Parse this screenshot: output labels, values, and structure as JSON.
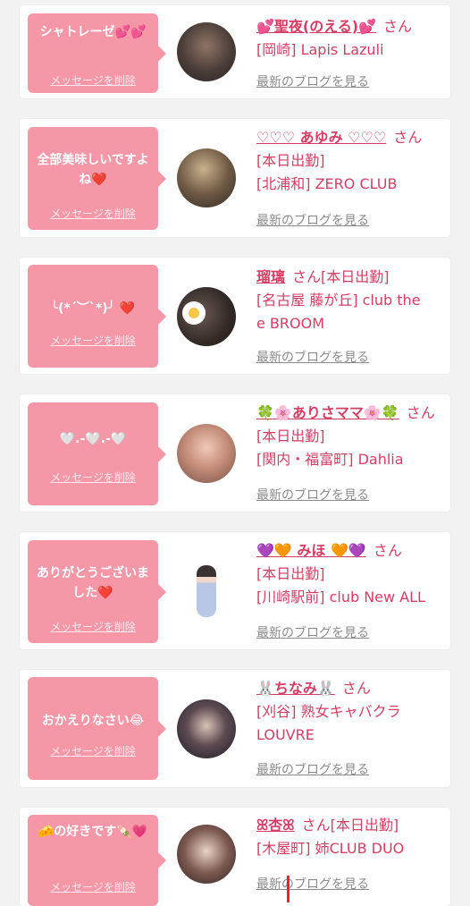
{
  "delete_label": "メッセージを削除",
  "blog_label": "最新のブログを見る",
  "san_label": "さん",
  "colors": {
    "bubble": "#f597a7",
    "accent": "#d73d63",
    "link_gray": "#8b8b8b"
  },
  "items": [
    {
      "message": "シャトレーゼ💕💕",
      "name": "💕聖夜(のえる)💕",
      "info_lines": [
        "[岡崎] Lapis Lazuli"
      ]
    },
    {
      "message": "全部美味しいですよね❤️",
      "name": "♡♡♡ あゆみ ♡♡♡",
      "status": "[本日出勤]",
      "info_lines": [
        "[北浦和] ZERO CLUB"
      ]
    },
    {
      "message": "╰(*´︶`*)╯ ❤️",
      "name": "瑠璃",
      "status": "[本日出勤]",
      "info_lines": [
        "[名古屋 藤が丘] club the",
        "e BROOM"
      ]
    },
    {
      "message": "🤍.-🤍.-🤍",
      "name": "🍀🌸ありさママ🌸🍀",
      "status": "[本日出勤]",
      "info_lines": [
        "[関内・福富町] Dahlia"
      ]
    },
    {
      "message": "ありがとうございました❤️",
      "name": "💜🧡 みほ 🧡💜",
      "status": "[本日出勤]",
      "info_lines": [
        "[川崎駅前] club New ALL"
      ]
    },
    {
      "message": "おかえりなさい😂",
      "name": "🐰ちなみ🐰",
      "info_lines": [
        "[刈谷] 熟女キャバクラ",
        "LOUVRE"
      ]
    },
    {
      "message": "🧀の好きです🍡💗",
      "name": "ꕤ杏ꕤ",
      "status": "[本日出勤]",
      "info_lines": [
        "[木屋町] 姉CLUB DUO"
      ]
    }
  ]
}
